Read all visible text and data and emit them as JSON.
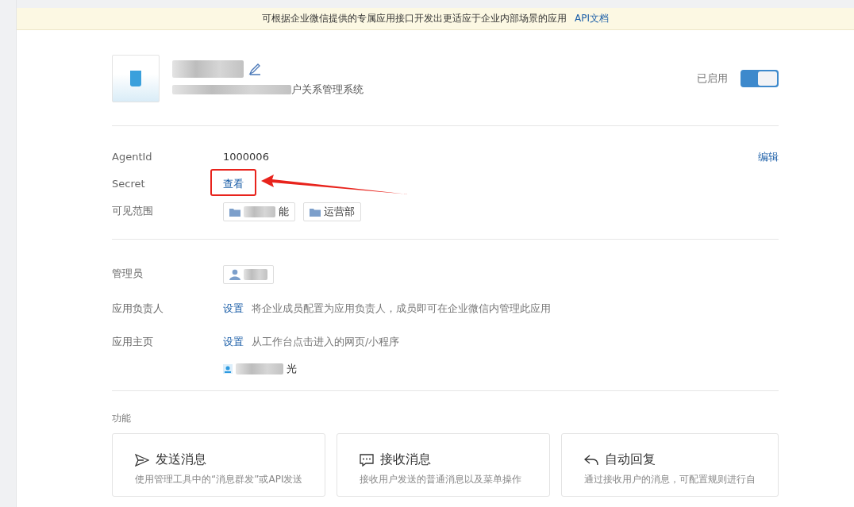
{
  "banner": {
    "text": "可根据企业微信提供的专属应用接口开发出更适应于企业内部场景的应用",
    "link": "API文档"
  },
  "app": {
    "subtitle": "户关系管理系统",
    "status_label": "已启用",
    "enabled": true
  },
  "info": {
    "edit_link": "编辑",
    "rows": [
      {
        "kind": "text",
        "label": "AgentId",
        "value": "1000006"
      },
      {
        "kind": "link",
        "label": "Secret",
        "value": "查看"
      },
      {
        "kind": "tags",
        "label": "可见范围",
        "tags": [
          {
            "text": "能",
            "blurred": true
          },
          {
            "text": "运营部",
            "blurred": false
          }
        ]
      }
    ]
  },
  "roles": [
    {
      "kind": "person-tag",
      "label": "管理员"
    },
    {
      "kind": "setting",
      "label": "应用负责人",
      "link": "设置",
      "hint": "将企业成员配置为应用负责人，成员即可在企业微信内管理此应用"
    },
    {
      "kind": "setting",
      "label": "应用主页",
      "link": "设置",
      "hint": "从工作台点击进入的网页/小程序",
      "member": "光"
    }
  ],
  "features": {
    "title": "功能",
    "cards": [
      {
        "kind": "send",
        "title": "发送消息",
        "desc": "使用管理工具中的“消息群发”或API发送"
      },
      {
        "kind": "receive",
        "title": "接收消息",
        "desc": "接收用户发送的普通消息以及菜单操作"
      },
      {
        "kind": "reply",
        "title": "自动回复",
        "desc": "通过接收用户的消息，可配置规则进行自"
      }
    ]
  }
}
